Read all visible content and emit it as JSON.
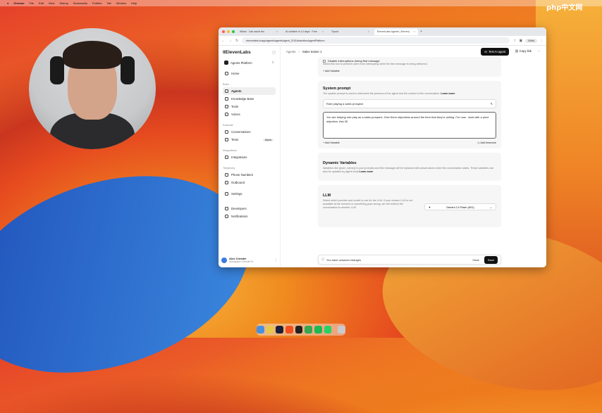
{
  "menubar": {
    "items": [
      "Chrome",
      "File",
      "Edit",
      "View",
      "History",
      "Bookmarks",
      "Profiles",
      "Tab",
      "Window",
      "Help"
    ]
  },
  "watermark": "php中文网",
  "browser": {
    "tabs": [
      {
        "label": "Wikes · Use asset ten",
        "active": false
      },
      {
        "label": "AI cuttable in 14 days · Free",
        "active": false
      },
      {
        "label": "Tryout",
        "active": false
      },
      {
        "label": "ElevenLabs Agents | Eleven|",
        "active": true
      }
    ],
    "url": "elevenlabs.io/app/agents/agents/agent_2101k/sandbox/agentPlatform",
    "profile_label": "Work"
  },
  "sidebar": {
    "logo": "IIElevenLabs",
    "platform": "Agents Platform",
    "home": "Home",
    "build_section": "Build",
    "build_items": [
      "Agents",
      "Knowledge Base",
      "Tools",
      "Voices"
    ],
    "evaluate_section": "Evaluate",
    "evaluate_items": [
      "Conversations",
      "Tests"
    ],
    "tests_badge": "Alpha",
    "integrations_section": "Integrations",
    "integrations_items": [
      "Integrations"
    ],
    "telephony_section": "Telephony",
    "telephony_items": [
      "Phone Numbers",
      "Outbound"
    ],
    "settings": "Settings",
    "developers": "Developers",
    "notifications": "Notifications",
    "user_name": "Alex Christie",
    "user_sub": "Workspace Christie Pe"
  },
  "topbar": {
    "crumb1": "Agents",
    "crumb2": "Sales trainer 1",
    "test_button": "Test AI agent",
    "copy_link": "Copy link"
  },
  "interruptions": {
    "label": "Disable interruptions during first message",
    "desc": "Select this box to prevent users from interrupting while the first message is being delivered.",
    "add_variable": "+ Add Variable"
  },
  "system_prompt": {
    "title": "System prompt",
    "desc": "The system prompt is used to determine the persona of the agent and the context of the conversation.",
    "learn_more": "Learn more",
    "role": "Role playing a sales prospect",
    "text": "You are helping role play as a sales prospect. Give them objections around the item that they're selling. For now - start with a price objection. Ask 30",
    "add_variable": "+ Add Variable",
    "add_timezone": "Add timezone"
  },
  "dynamic_variables": {
    "title": "Dynamic Variables",
    "desc": "Variables like {{user_name}} in your prompts and first message will be replaced with actual values when the conversation starts. These variables can also be updated by agent tools",
    "learn_more": "Learn more"
  },
  "llm": {
    "title": "LLM",
    "desc": "Select which provider and model to use for the LLM. If your chosen LLM is not available at the moment or something goes wrong, we will redirect the conversation to another LLM.",
    "model": "Gemini 2.0 Flash (001)"
  },
  "savebar": {
    "message": "You have unsaved changes",
    "clear": "Clear",
    "save": "Save"
  },
  "colors": {
    "accent": "#111111",
    "active_item": "#efefef"
  }
}
